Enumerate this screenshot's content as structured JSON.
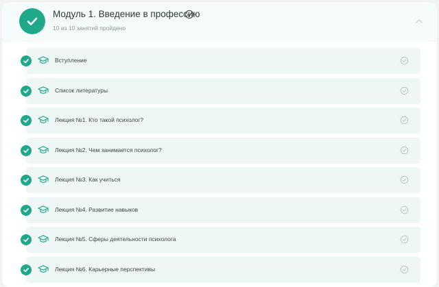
{
  "module": {
    "title": "Модуль 1. Введение в профессию",
    "progress": "10 из 10 занятий пройдено",
    "completed": true,
    "expanded": true
  },
  "lessons": [
    {
      "title": "Вступление",
      "completed": true
    },
    {
      "title": "Список литературы",
      "completed": true
    },
    {
      "title": "Лекция №1. Кто такой психолог?",
      "completed": true
    },
    {
      "title": "Лекция №2. Чем занимается психолог?",
      "completed": true
    },
    {
      "title": "Лекция №3. Как учиться",
      "completed": true
    },
    {
      "title": "Лекция №4. Развитие навыков",
      "completed": true
    },
    {
      "title": "Лекция №5. Сферы деятельности психолога",
      "completed": true
    },
    {
      "title": "Лекция №6. Карьерные перспективы",
      "completed": true
    }
  ],
  "colors": {
    "accent": "#1fa889",
    "row_background": "#eef7f5",
    "header_background": "#f5fbfa",
    "muted_icon": "#b9c3c0"
  },
  "icons": {
    "module_status": "check-circle-icon",
    "module_badge": "badge-check-icon",
    "lesson_status": "check-circle-icon",
    "lesson_type": "graduation-cap-icon",
    "lesson_done": "check-outline-icon",
    "collapse": "chevron-up-icon"
  }
}
